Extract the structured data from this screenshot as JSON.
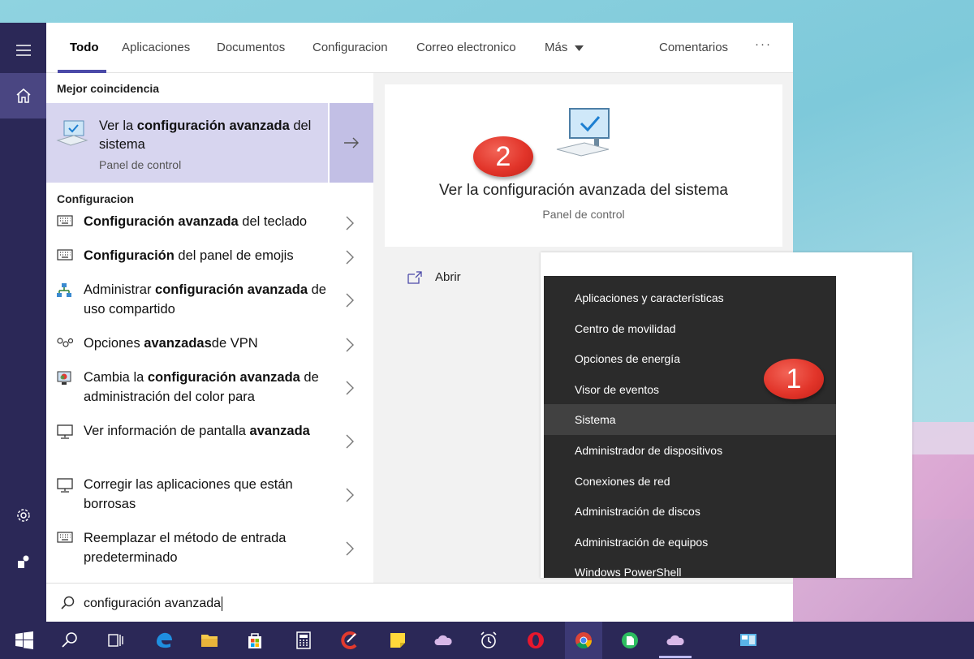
{
  "tabs": [
    "Todo",
    "Aplicaciones",
    "Documentos",
    "Configuracion",
    "Correo electronico",
    "Más",
    "Comentarios"
  ],
  "more_dots": "···",
  "best_match": {
    "section_label": "Mejor coincidencia",
    "title_pre": "Ver la ",
    "title_bold": "configuración avanzada",
    "title_post": " del sistema",
    "subtitle": "Panel de control"
  },
  "settings_section_label": "Configuracion",
  "results": [
    {
      "pre": "",
      "bold": "Configuración avanzada",
      "post": " del teclado",
      "icon": "keyboard-icon"
    },
    {
      "pre": "",
      "bold": "Configuración",
      "post": " del panel de emojis",
      "icon": "keyboard-icon"
    },
    {
      "pre": "Administrar ",
      "bold": "configuración avanzada",
      "post": " de uso compartido",
      "icon": "network-share-icon"
    },
    {
      "pre": "Opciones ",
      "bold": "avanzadas",
      "post": "de VPN",
      "icon": "vpn-icon"
    },
    {
      "pre": "Cambia la ",
      "bold": "configuración avanzada",
      "post": " de administración del color para",
      "icon": "color-management-icon"
    },
    {
      "pre": "Ver información de pantalla ",
      "bold": "avanzada",
      "post": "",
      "icon": "monitor-icon"
    },
    {
      "pre": "Corregir las aplicaciones que están borrosas",
      "bold": "",
      "post": "",
      "icon": "monitor-icon"
    },
    {
      "pre": "Reemplazar el método de entrada predeterminado",
      "bold": "",
      "post": "",
      "icon": "keyboard-icon"
    }
  ],
  "preview": {
    "title": "Ver la configuración avanzada del sistema",
    "subtitle": "Panel de control"
  },
  "open_label": "Abrir",
  "search": {
    "value": "configuración avanzada"
  },
  "winx_menu": [
    "Aplicaciones y características",
    "Centro de movilidad",
    "Opciones de energía",
    "Visor de eventos",
    "Sistema",
    "Administrador de dispositivos",
    "Conexiones de red",
    "Administración de discos",
    "Administración de equipos",
    "Windows PowerShell"
  ],
  "winx_highlight_index": 4,
  "badges": {
    "one": "1",
    "two": "2"
  },
  "colors": {
    "rail": "#2b2857",
    "accent": "#4b4aa8",
    "selected": "#d7d5ef",
    "menu": "#2b2b2b",
    "badge": "#e2352a"
  }
}
